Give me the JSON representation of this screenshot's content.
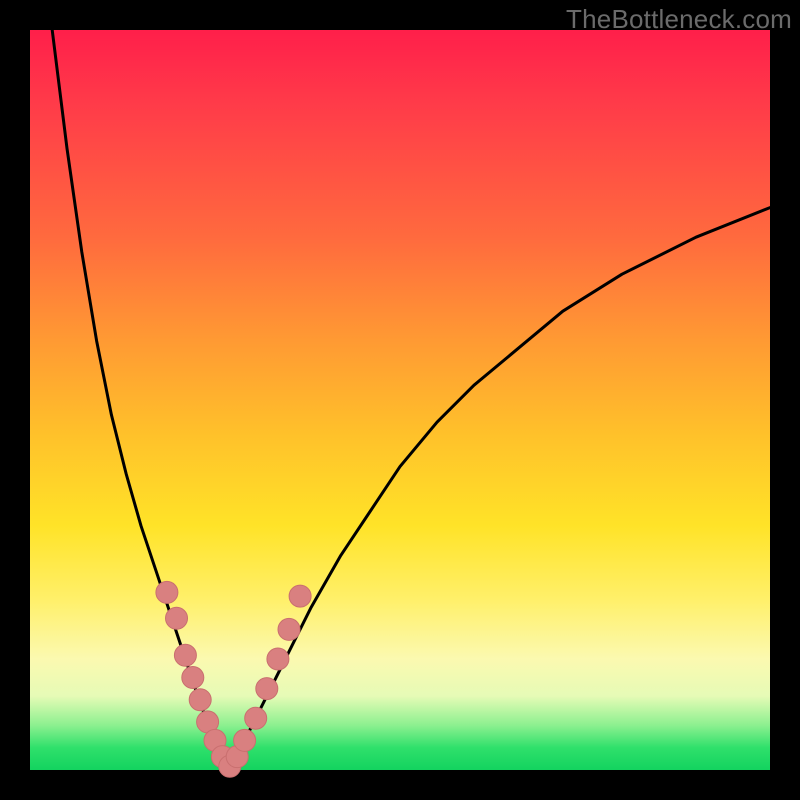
{
  "watermark": "TheBottleneck.com",
  "colors": {
    "curve": "#000000",
    "dot_fill": "#d98080",
    "dot_stroke": "#c96f6f"
  },
  "chart_data": {
    "type": "line",
    "title": "",
    "xlabel": "",
    "ylabel": "",
    "xlim": [
      0,
      100
    ],
    "ylim": [
      0,
      100
    ],
    "grid": false,
    "notes": "V-shaped bottleneck curve. Minimum (y≈0) occurs near x≈27. Left branch rises steeply toward y=100 as x→3. Right branch rises with decreasing slope toward y≈76 at x=100. Salmon dots cluster along both branches in the lower ~30% of the y-range.",
    "series": [
      {
        "name": "curve-left",
        "x": [
          3,
          5,
          7,
          9,
          11,
          13,
          15,
          17,
          19,
          21,
          23,
          25,
          27
        ],
        "y": [
          100,
          84,
          70,
          58,
          48,
          40,
          33,
          27,
          21,
          15,
          9,
          4,
          0
        ]
      },
      {
        "name": "curve-right",
        "x": [
          27,
          30,
          34,
          38,
          42,
          46,
          50,
          55,
          60,
          66,
          72,
          80,
          90,
          100
        ],
        "y": [
          0,
          6,
          14,
          22,
          29,
          35,
          41,
          47,
          52,
          57,
          62,
          67,
          72,
          76
        ]
      },
      {
        "name": "dots",
        "x": [
          18.5,
          19.8,
          21.0,
          22.0,
          23.0,
          24.0,
          25.0,
          26.0,
          27.0,
          28.0,
          29.0,
          30.5,
          32.0,
          33.5,
          35.0,
          36.5
        ],
        "y": [
          24.0,
          20.5,
          15.5,
          12.5,
          9.5,
          6.5,
          4.0,
          1.8,
          0.5,
          1.8,
          4.0,
          7.0,
          11.0,
          15.0,
          19.0,
          23.5
        ]
      }
    ]
  }
}
